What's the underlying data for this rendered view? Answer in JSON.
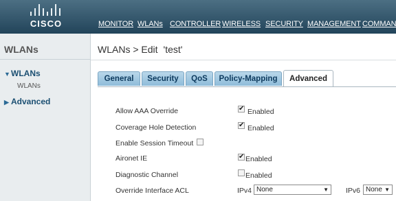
{
  "brand": {
    "logo_text": "CISCO"
  },
  "nav": {
    "items": [
      "MONITOR",
      "WLANs",
      "CONTROLLER",
      "WIRELESS",
      "SECURITY",
      "MANAGEMENT",
      "COMMANDS"
    ],
    "active": "WLANs"
  },
  "sidebar": {
    "title": "WLANs",
    "items": [
      {
        "label": "WLANs",
        "expanded": true,
        "sub": "WLANs"
      },
      {
        "label": "Advanced",
        "expanded": false
      }
    ]
  },
  "page": {
    "title": "WLANs > Edit",
    "wlan_name": "'test'"
  },
  "tabs": [
    "General",
    "Security",
    "QoS",
    "Policy-Mapping",
    "Advanced"
  ],
  "active_tab": "Advanced",
  "form": {
    "allow_aaa": {
      "label": "Allow AAA Override",
      "checked": true,
      "value_label": "Enabled"
    },
    "coverage_hole": {
      "label": "Coverage Hole Detection",
      "checked": true,
      "value_label": "Enabled"
    },
    "session_timeout": {
      "label": "Enable Session Timeout",
      "checked": false
    },
    "aironet_ie": {
      "label": "Aironet IE",
      "checked": true,
      "value_label": "Enabled"
    },
    "diagnostic": {
      "label": "Diagnostic Channel",
      "checked": false,
      "value_label": "Enabled"
    },
    "override_acl": {
      "label": "Override Interface ACL",
      "ipv4_label": "IPv4",
      "ipv4_value": "None",
      "ipv6_label": "IPv6",
      "ipv6_value": "None"
    }
  }
}
